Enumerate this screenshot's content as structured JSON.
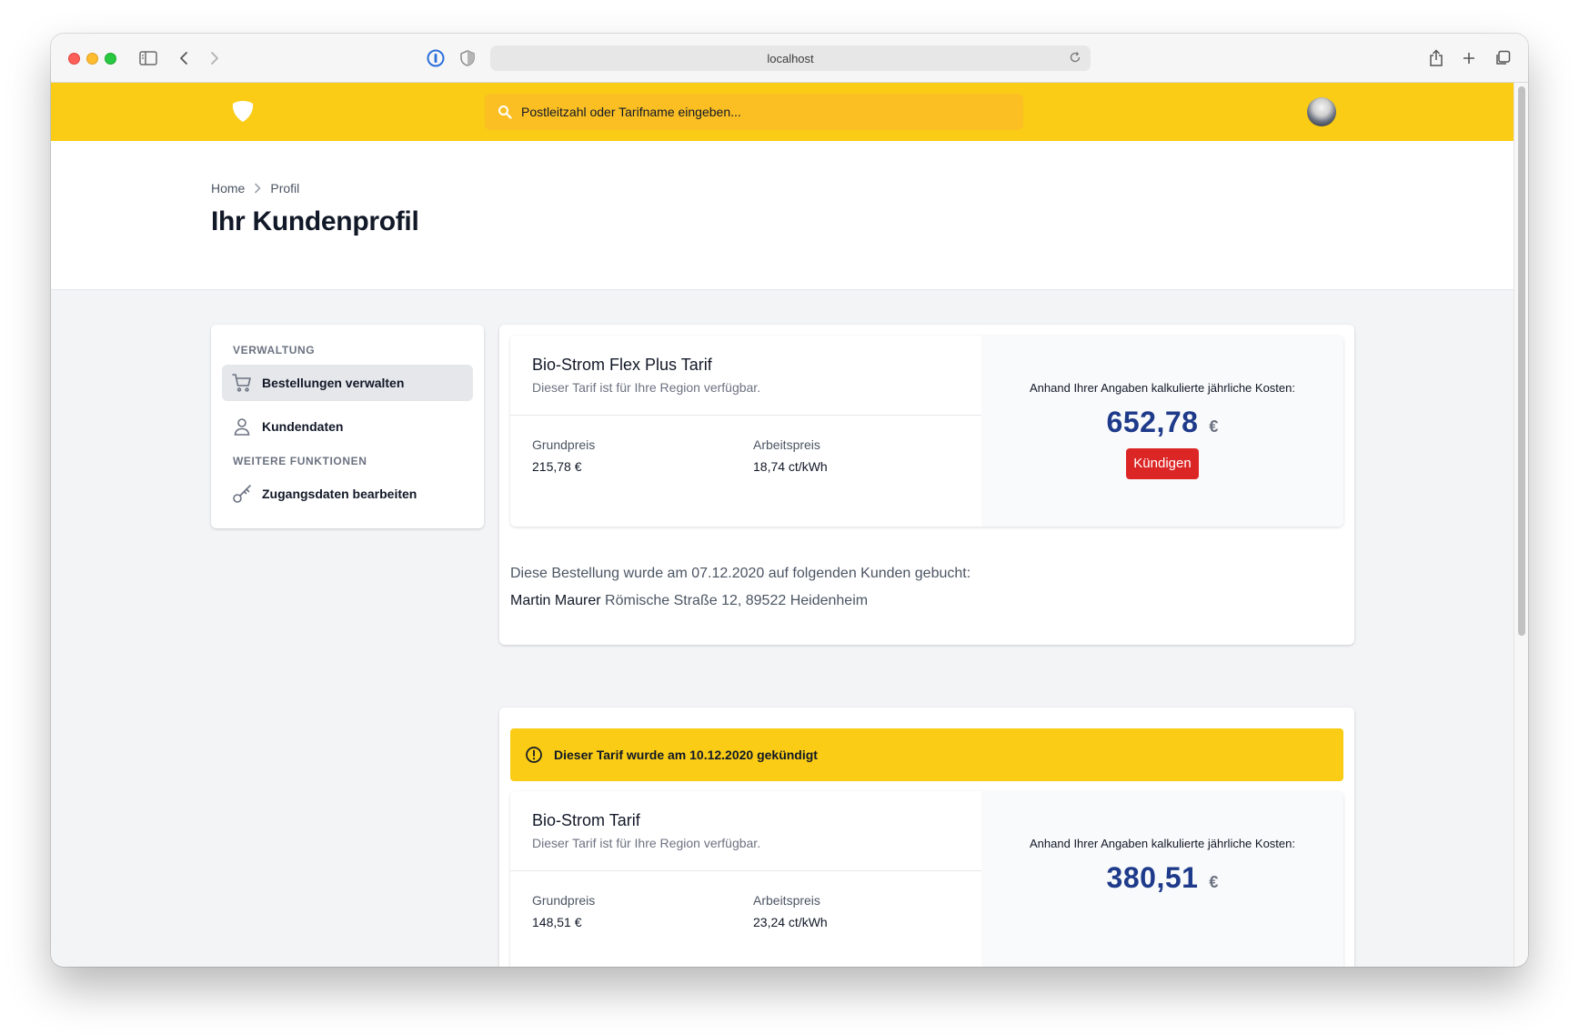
{
  "browser": {
    "url": "localhost"
  },
  "nav": {
    "search_placeholder": "Postleitzahl oder Tarifname eingeben..."
  },
  "header": {
    "breadcrumb": [
      "Home",
      "Profil"
    ],
    "title": "Ihr Kundenprofil"
  },
  "sidebar": {
    "heading_admin": "VERWALTUNG",
    "item_orders": "Bestellungen verwalten",
    "item_customer": "Kundendaten",
    "heading_more": "WEITERE FUNKTIONEN",
    "item_access": "Zugangsdaten bearbeiten"
  },
  "orders": [
    {
      "tariff_name": "Bio-Strom Flex Plus Tarif",
      "availability": "Dieser Tarif ist für Ihre Region verfügbar.",
      "base_price_label": "Grundpreis",
      "base_price": "215,78 €",
      "work_price_label": "Arbeitspreis",
      "work_price": "18,74 ct/kWh",
      "cost_label": "Anhand Ihrer Angaben kalkulierte jährliche Kosten:",
      "cost": "652,78",
      "currency": "€",
      "cancel_label": "Kündigen",
      "booking_note": "Diese Bestellung wurde am 07.12.2020 auf folgenden Kunden gebucht:",
      "customer_name": "Martin Maurer",
      "customer_address": "Römische Straße 12, 89522 Heidenheim"
    },
    {
      "alert": "Dieser Tarif wurde am 10.12.2020 gekündigt",
      "tariff_name": "Bio-Strom Tarif",
      "availability": "Dieser Tarif ist für Ihre Region verfügbar.",
      "base_price_label": "Grundpreis",
      "base_price": "148,51 €",
      "work_price_label": "Arbeitspreis",
      "work_price": "23,24 ct/kWh",
      "cost_label": "Anhand Ihrer Angaben kalkulierte jährliche Kosten:",
      "cost": "380,51",
      "currency": "€"
    }
  ],
  "colors": {
    "brand_yellow": "#facc15",
    "search_bg": "#fbbf24",
    "cost_blue": "#1e3a8a",
    "danger_red": "#dc2626"
  }
}
